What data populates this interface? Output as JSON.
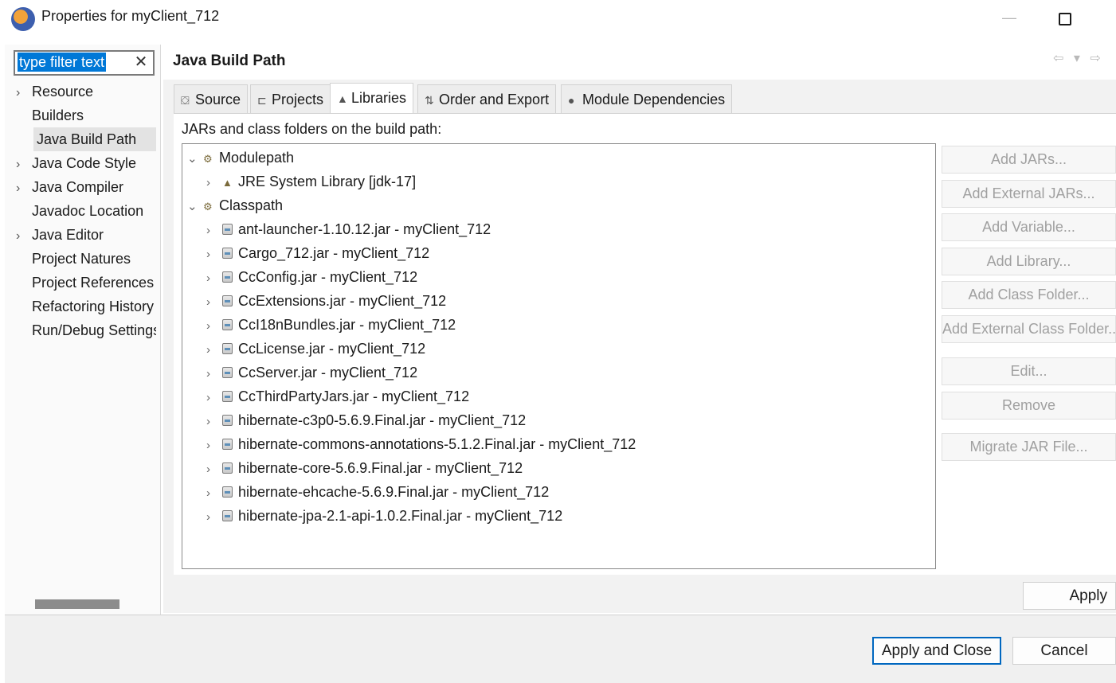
{
  "window": {
    "title": "Properties for myClient_712",
    "minimize_glyph": "—"
  },
  "filter": {
    "text": "type filter text",
    "clear_glyph": "✕"
  },
  "nav": {
    "items": [
      {
        "label": "Resource",
        "expandable": true
      },
      {
        "label": "Builders",
        "expandable": false
      },
      {
        "label": "Java Build Path",
        "expandable": false,
        "selected": true
      },
      {
        "label": "Java Code Style",
        "expandable": true
      },
      {
        "label": "Java Compiler",
        "expandable": true
      },
      {
        "label": "Javadoc Location",
        "expandable": false
      },
      {
        "label": "Java Editor",
        "expandable": true
      },
      {
        "label": "Project Natures",
        "expandable": false
      },
      {
        "label": "Project References",
        "expandable": false
      },
      {
        "label": "Refactoring History",
        "expandable": false
      },
      {
        "label": "Run/Debug Settings",
        "expandable": false
      }
    ]
  },
  "page": {
    "title": "Java Build Path",
    "history_nav": "⇦ ▾ ⇨"
  },
  "tabs": [
    {
      "label": "Source",
      "icon": "source-folder-icon",
      "glyph": "⛋"
    },
    {
      "label": "Projects",
      "icon": "projects-folder-icon",
      "glyph": "⊏"
    },
    {
      "label": "Libraries",
      "icon": "libraries-icon",
      "glyph": "▲",
      "active": true
    },
    {
      "label": "Order and Export",
      "icon": "order-export-icon",
      "glyph": "⇅"
    },
    {
      "label": "Module Dependencies",
      "icon": "module-icon",
      "glyph": "●"
    }
  ],
  "libraries": {
    "label": "JARs and class folders on the build path:",
    "groups": [
      {
        "name": "Modulepath",
        "entries": [
          "JRE System Library [jdk-17]"
        ],
        "entry_icon": "jre-library-icon"
      },
      {
        "name": "Classpath",
        "entry_icon": "jar-icon",
        "entries": [
          "ant-launcher-1.10.12.jar - myClient_712",
          "Cargo_712.jar - myClient_712",
          "CcConfig.jar - myClient_712",
          "CcExtensions.jar - myClient_712",
          "CcI18nBundles.jar - myClient_712",
          "CcLicense.jar - myClient_712",
          "CcServer.jar - myClient_712",
          "CcThirdPartyJars.jar - myClient_712",
          "hibernate-c3p0-5.6.9.Final.jar - myClient_712",
          "hibernate-commons-annotations-5.1.2.Final.jar - myClient_712",
          "hibernate-core-5.6.9.Final.jar - myClient_712",
          "hibernate-ehcache-5.6.9.Final.jar - myClient_712",
          "hibernate-jpa-2.1-api-1.0.2.Final.jar - myClient_712"
        ]
      }
    ],
    "buttons": [
      "Add JARs...",
      "Add External JARs...",
      "Add Variable...",
      "Add Library...",
      "Add Class Folder...",
      "Add External Class Folder...",
      "Edit...",
      "Remove",
      "Migrate JAR File..."
    ]
  },
  "footer": {
    "apply": "Apply",
    "apply_and_close": "Apply and Close",
    "cancel": "Cancel"
  },
  "colors": {
    "selection": "#0078d7",
    "default_button_border": "#0067c0",
    "disabled_text": "#a0a0a0"
  }
}
